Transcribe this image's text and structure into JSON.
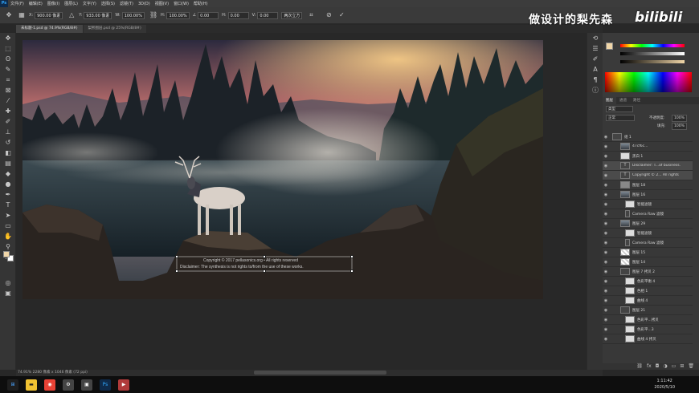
{
  "menubar": {
    "items": [
      "文件(F)",
      "编辑(E)",
      "图像(I)",
      "图层(L)",
      "文字(Y)",
      "选择(S)",
      "滤镜(T)",
      "3D(D)",
      "视图(V)",
      "窗口(W)",
      "帮助(H)"
    ]
  },
  "options": {
    "x_label": "X:",
    "x_value": "900.00 像素",
    "y_label": "Y:",
    "y_value": "933.00 像素",
    "w_label": "W:",
    "w_value": "100.00%",
    "h_label": "H:",
    "h_value": "100.00%",
    "angle_value": "0.00",
    "hskew_label": "H:",
    "hskew_value": "0.00",
    "vskew_label": "V:",
    "vskew_value": "0.00",
    "interp_value": "两次立方"
  },
  "watermark": {
    "text": "做设计的梨先森",
    "brand": "bilibili"
  },
  "tabs": [
    {
      "label": "未标题-1.psd @ 74.9%(RGB/8#)"
    },
    {
      "label": "梨熙图层.psd @ 25%(RGB/8#)"
    }
  ],
  "canvas": {
    "overlay_line1": "Copyright © 2017 pellasonics.org  •  All rights reserved",
    "overlay_line2": "Disclaimer: The synthesis is not rights to/from the use of these works."
  },
  "color_panel": {
    "fg_color": "#f0d6a8",
    "bg_color": "#ffffff"
  },
  "layers_panel": {
    "tabs": [
      "图层",
      "通道",
      "路径"
    ],
    "blend_mode": "正常",
    "opacity_label": "不透明度:",
    "opacity_value": "100%",
    "fill_label": "填充:",
    "fill_value": "100%",
    "kind_filter": "类型",
    "layers": [
      {
        "name": "组 1"
      },
      {
        "name": "47cf6c..."
      },
      {
        "name": "黑白 1"
      },
      {
        "name": "Disclaimer: T...of business."
      },
      {
        "name": "Copyright © 2... All rights"
      },
      {
        "name": "图层 18"
      },
      {
        "name": "图层 16"
      },
      {
        "name": "智能滤镜"
      },
      {
        "name": "Camera Raw 滤镜"
      },
      {
        "name": "图层 29"
      },
      {
        "name": "智能滤镜"
      },
      {
        "name": "Camera Raw 滤镜"
      },
      {
        "name": "图层 15"
      },
      {
        "name": "图层 14"
      },
      {
        "name": "图层 7 拷贝 2"
      },
      {
        "name": "色彩平衡 4"
      },
      {
        "name": "色相 1"
      },
      {
        "name": "曲线 4"
      },
      {
        "name": "图层 21"
      },
      {
        "name": "色彩平...拷贝"
      },
      {
        "name": "色彩平...3"
      },
      {
        "name": "曲线 4 拷贝"
      }
    ]
  },
  "statusbar": {
    "text": "74.91%    2280 像素 x 1046 像素 (72 ppi)"
  },
  "taskbar": {
    "time": "1:11:42",
    "date": "2020/5/10"
  }
}
